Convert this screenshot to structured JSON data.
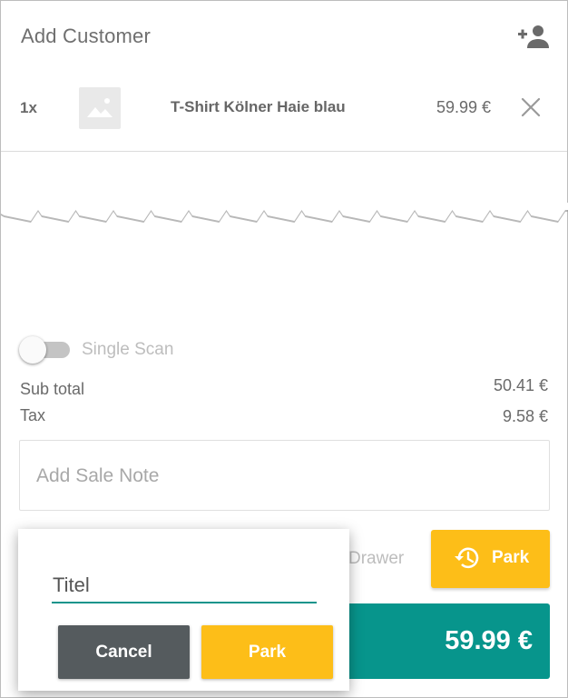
{
  "header": {
    "add_customer_label": "Add Customer",
    "add_customer_icon": "person-add-icon"
  },
  "cart": {
    "items": [
      {
        "quantity": "1x",
        "image_icon": "image-placeholder-icon",
        "name": "T-Shirt Kölner Haie blau",
        "price": "59.99 €",
        "remove_icon": "close-icon"
      }
    ]
  },
  "options": {
    "single_scan_label": "Single Scan",
    "single_scan_enabled": false
  },
  "totals": {
    "subtotal_label": "Sub total",
    "subtotal_value": "50.41 €",
    "tax_label": "Tax",
    "tax_value": "9.58 €"
  },
  "sale_note": {
    "placeholder": "Add Sale Note"
  },
  "actions": {
    "drawer_label": "Drawer",
    "park_label": "Park",
    "park_icon": "history-icon",
    "pay_amount": "59.99 €"
  },
  "park_dialog": {
    "title_value": "Titel",
    "cancel_label": "Cancel",
    "park_label": "Park"
  },
  "colors": {
    "accent_yellow": "#fdbe18",
    "accent_teal": "#07958c",
    "cancel_gray": "#555b5e"
  }
}
